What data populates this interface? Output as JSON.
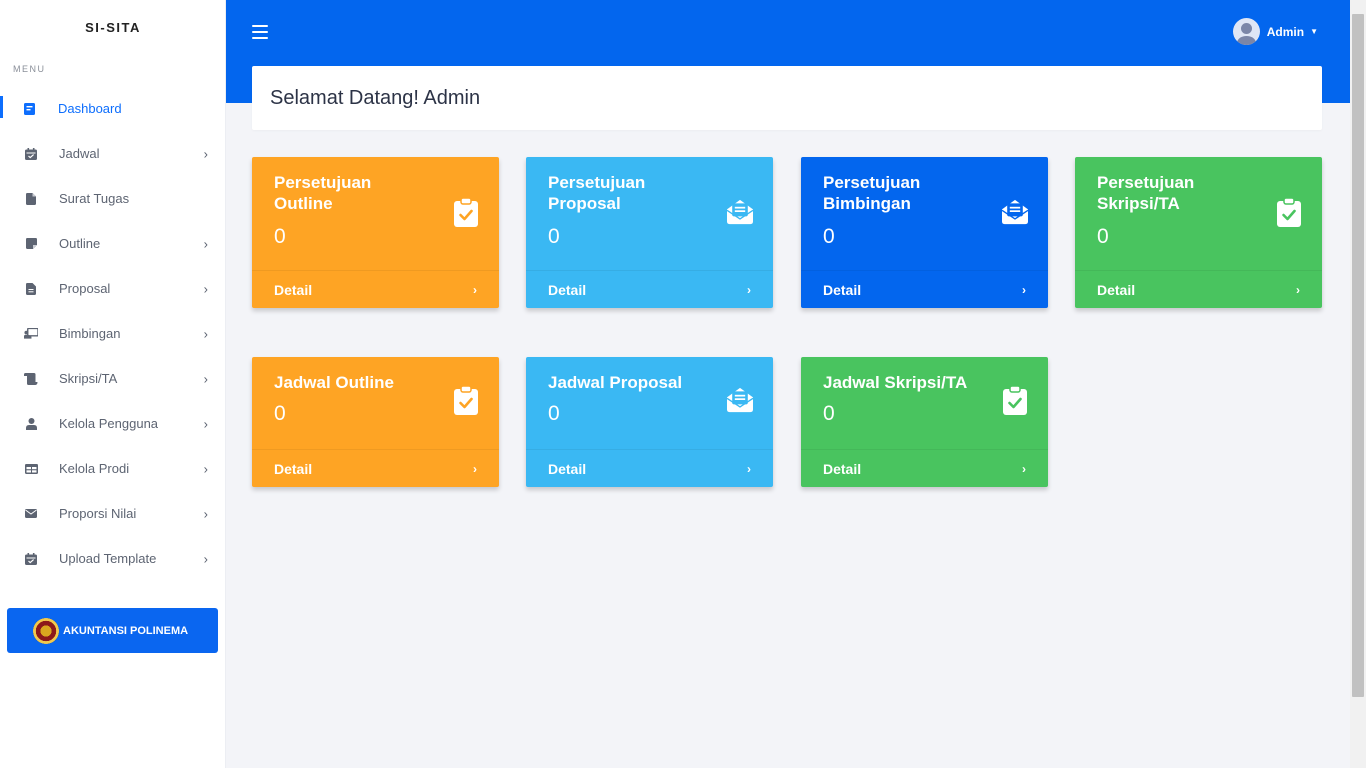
{
  "app": {
    "brand": "SI-SITA",
    "menu_title": "MENU"
  },
  "sidebar": {
    "items": [
      {
        "label": "Dashboard",
        "icon": "dashboard-icon"
      },
      {
        "label": "Jadwal",
        "icon": "calendar-icon"
      },
      {
        "label": "Surat Tugas",
        "icon": "file-icon"
      },
      {
        "label": "Outline",
        "icon": "note-icon"
      },
      {
        "label": "Proposal",
        "icon": "document-icon"
      },
      {
        "label": "Bimbingan",
        "icon": "chalkboard-icon"
      },
      {
        "label": "Skripsi/TA",
        "icon": "scroll-icon"
      },
      {
        "label": "Kelola Pengguna",
        "icon": "user-icon"
      },
      {
        "label": "Kelola Prodi",
        "icon": "table-icon"
      },
      {
        "label": "Proporsi Nilai",
        "icon": "envelope-icon"
      },
      {
        "label": "Upload Template",
        "icon": "calendar-check-icon"
      }
    ],
    "org_badge": "AKUNTANSI POLINEMA"
  },
  "header": {
    "user": "Admin"
  },
  "welcome": "Selamat Datang! Admin",
  "cards_row1": [
    {
      "title": "Persetujuan Outline",
      "count": "0",
      "footer": "Detail",
      "icon": "clipboard-check-icon",
      "color": "#fea424"
    },
    {
      "title": "Persetujuan Proposal",
      "count": "0",
      "footer": "Detail",
      "icon": "envelope-open-text-icon",
      "color": "#3ab8f3"
    },
    {
      "title": "Persetujuan Bimbingan",
      "count": "0",
      "footer": "Detail",
      "icon": "envelope-open-text-icon",
      "color": "#0366ee"
    },
    {
      "title": "Persetujuan Skripsi/TA",
      "count": "0",
      "footer": "Detail",
      "icon": "clipboard-check-icon",
      "color": "#49c45f"
    }
  ],
  "cards_row2": [
    {
      "title": "Jadwal Outline",
      "count": "0",
      "footer": "Detail",
      "icon": "clipboard-check-icon",
      "color": "#fea424"
    },
    {
      "title": "Jadwal Proposal",
      "count": "0",
      "footer": "Detail",
      "icon": "envelope-open-text-icon",
      "color": "#3ab8f3"
    },
    {
      "title": "Jadwal Skripsi/TA",
      "count": "0",
      "footer": "Detail",
      "icon": "clipboard-check-icon",
      "color": "#49c45f"
    }
  ],
  "colors": {
    "primary": "#0366ee",
    "orange": "#fea424",
    "sky": "#3ab8f3",
    "green": "#49c45f"
  }
}
